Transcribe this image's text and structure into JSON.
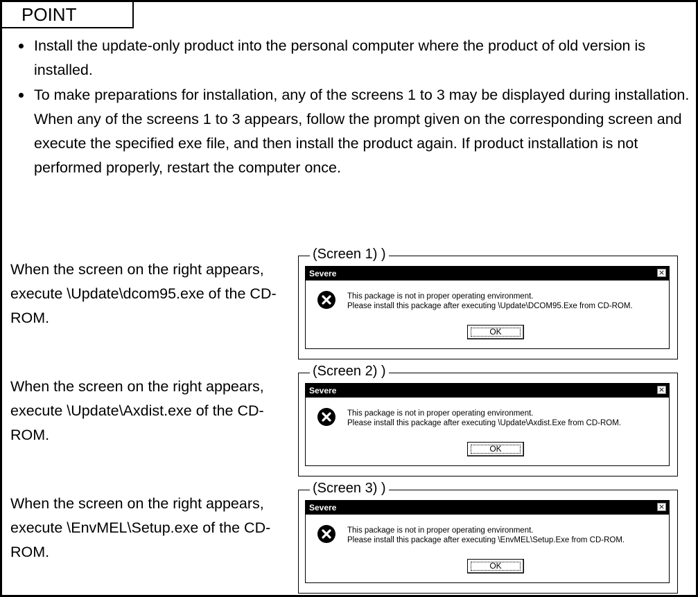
{
  "point": {
    "label": "POINT"
  },
  "bullets": [
    "Install the update-only product into the personal computer where the product of old version is installed.",
    "To make preparations for installation, any of the screens 1 to 3 may be displayed during installation. When any of the screens 1 to 3 appears, follow the prompt given on the corresponding screen and execute the specified exe file, and then install the product again. If product installation is not performed properly, restart the computer once."
  ],
  "screens": [
    {
      "description": "When the screen on the right appears, execute \\Update\\dcom95.exe of the CD-ROM.",
      "legend": "(Screen 1) )",
      "dialog": {
        "title": "Severe",
        "close": "×",
        "line1": "This package is not in proper operating environment.",
        "line2": "Please install this package after executing \\Update\\DCOM95.Exe from CD-ROM.",
        "ok": "OK"
      }
    },
    {
      "description": "When the screen on the right appears, execute \\Update\\Axdist.exe of the CD-ROM.",
      "legend": "(Screen 2) )",
      "dialog": {
        "title": "Severe",
        "close": "×",
        "line1": "This package is not in proper operating environment.",
        "line2": "Please install this package after executing \\Update\\Axdist.Exe from CD-ROM.",
        "ok": "OK"
      }
    },
    {
      "description": "When the screen on the right appears, execute \\EnvMEL\\Setup.exe of the CD-ROM.",
      "legend": "(Screen 3) )",
      "dialog": {
        "title": "Severe",
        "close": "×",
        "line1": "This package is not in proper operating environment.",
        "line2": "Please install this package after executing  \\EnvMEL\\Setup.Exe from CD-ROM.",
        "ok": "OK"
      }
    }
  ]
}
